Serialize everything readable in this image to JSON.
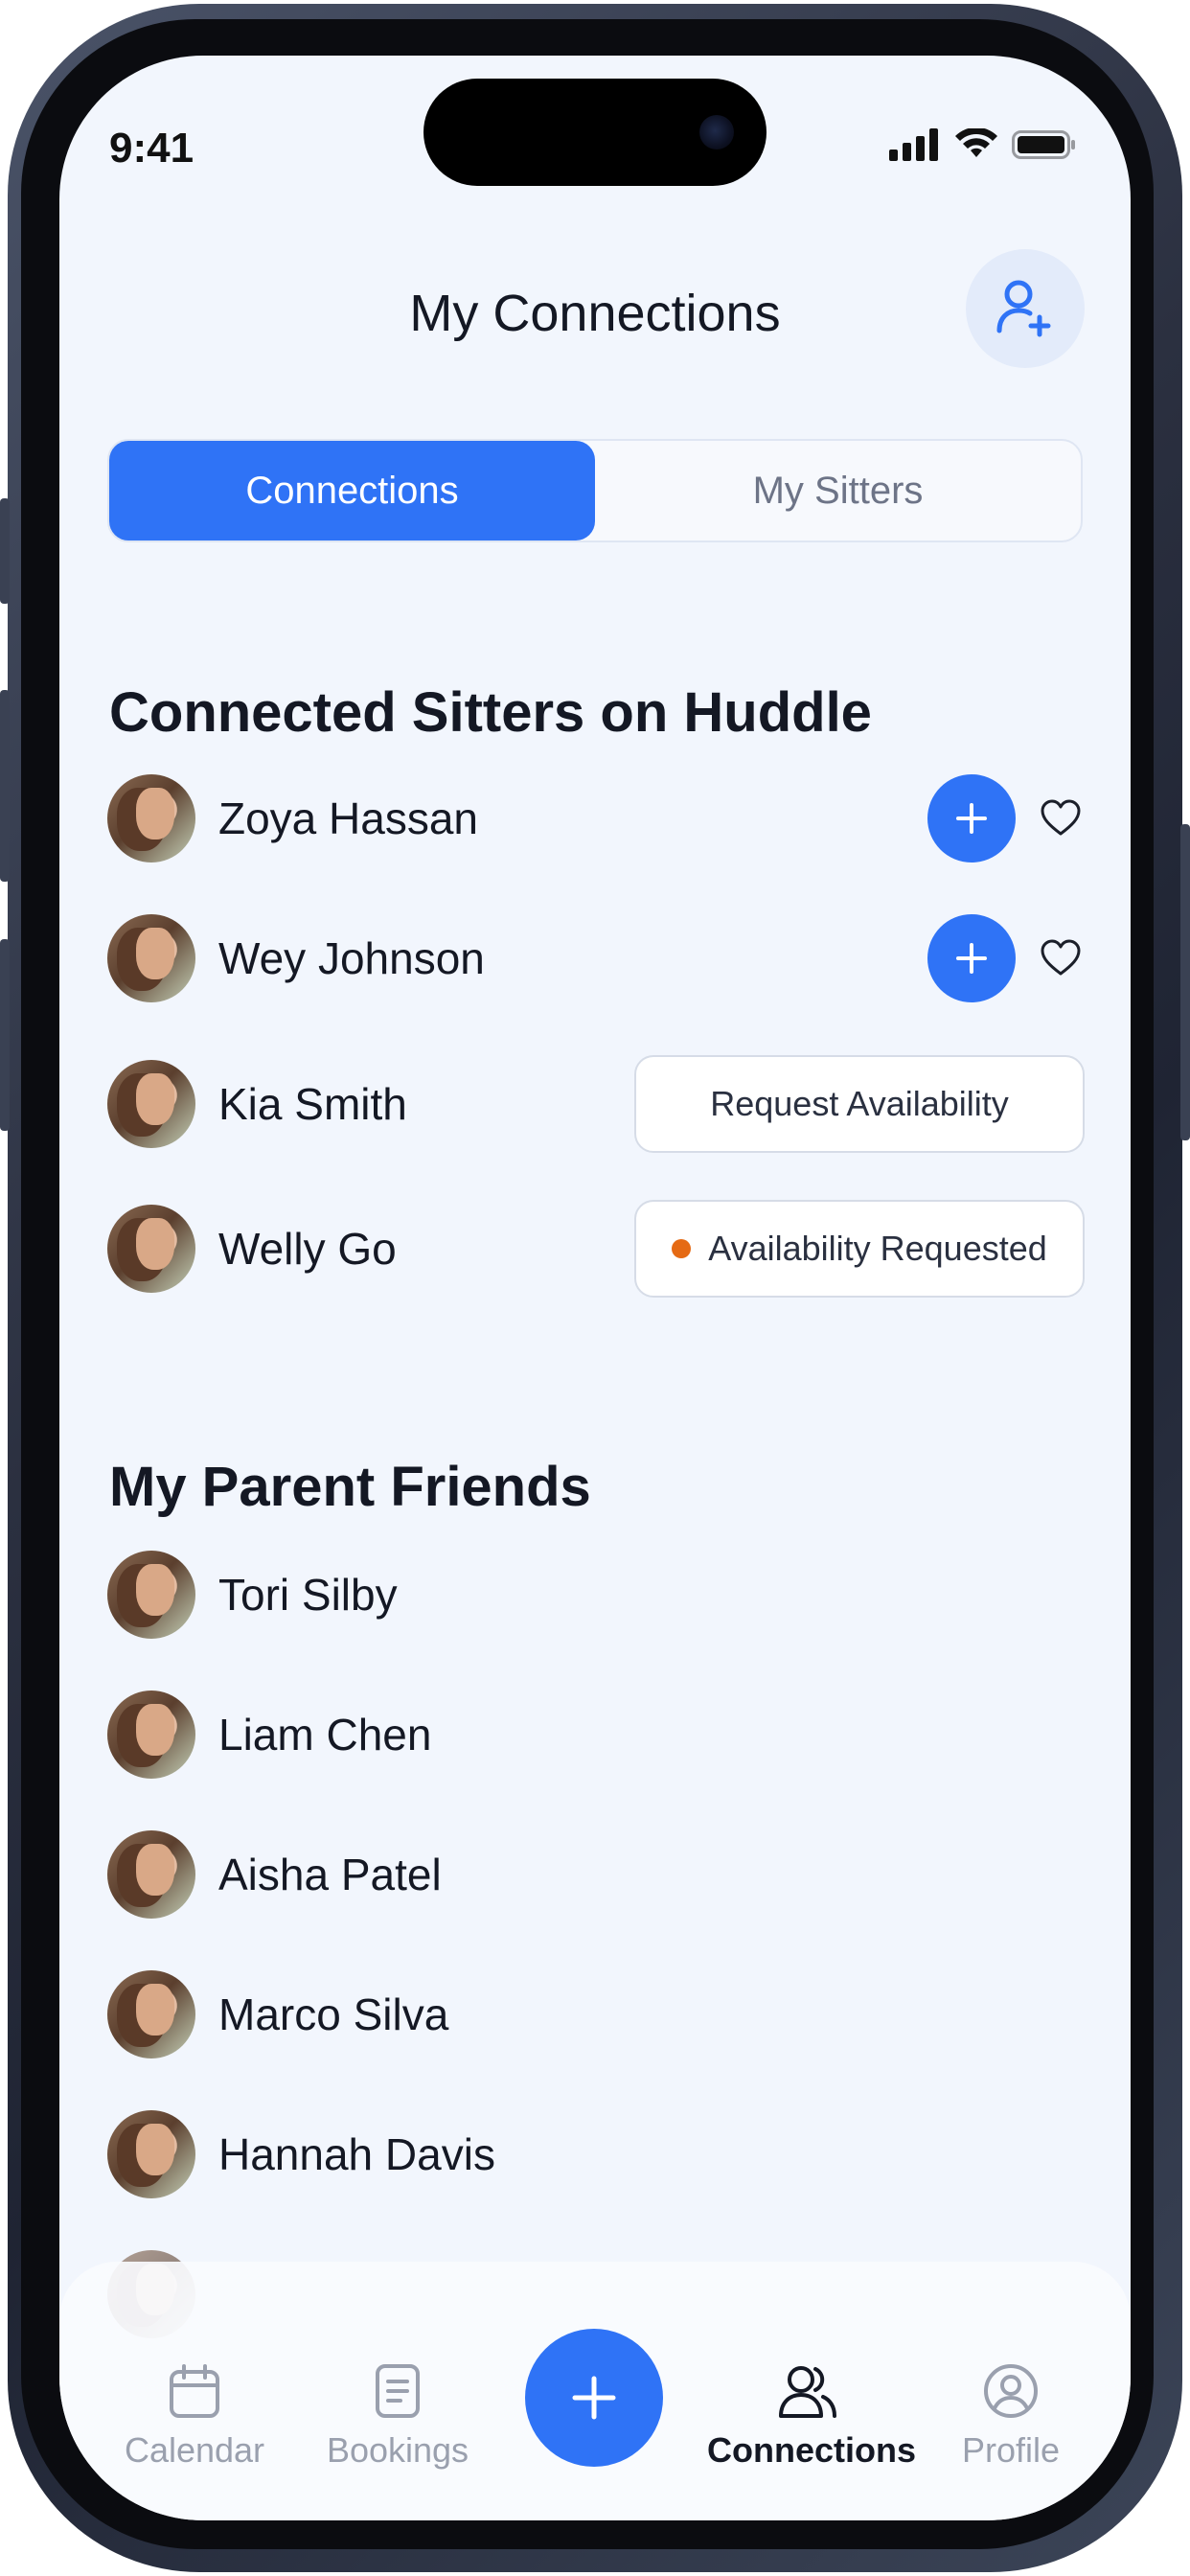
{
  "status_bar": {
    "time": "9:41"
  },
  "header": {
    "title": "My Connections"
  },
  "tabs": [
    {
      "label": "Connections",
      "active": true
    },
    {
      "label": "My Sitters",
      "active": false
    }
  ],
  "sitters_section": {
    "title": "Connected Sitters on Huddle",
    "items": [
      {
        "name": "Zoya Hassan",
        "action": "add"
      },
      {
        "name": "Wey Johnson",
        "action": "add"
      },
      {
        "name": "Kia Smith",
        "action": "request",
        "button_label": "Request Availability"
      },
      {
        "name": "Welly Go",
        "action": "requested",
        "button_label": "Availability Requested"
      }
    ]
  },
  "friends_section": {
    "title": "My Parent Friends",
    "items": [
      {
        "name": "Tori Silby"
      },
      {
        "name": "Liam Chen"
      },
      {
        "name": "Aisha Patel"
      },
      {
        "name": "Marco Silva"
      },
      {
        "name": "Hannah Davis"
      }
    ]
  },
  "bottom_nav": {
    "items": [
      {
        "label": "Calendar",
        "icon": "calendar-icon"
      },
      {
        "label": "Bookings",
        "icon": "document-icon"
      },
      {
        "label": "Connections",
        "icon": "people-icon",
        "active": true
      },
      {
        "label": "Profile",
        "icon": "user-circle-icon"
      }
    ],
    "fab_icon": "plus-icon"
  },
  "colors": {
    "accent": "#2f73f6",
    "background": "#f2f6fd",
    "requested_dot": "#e56a14"
  }
}
